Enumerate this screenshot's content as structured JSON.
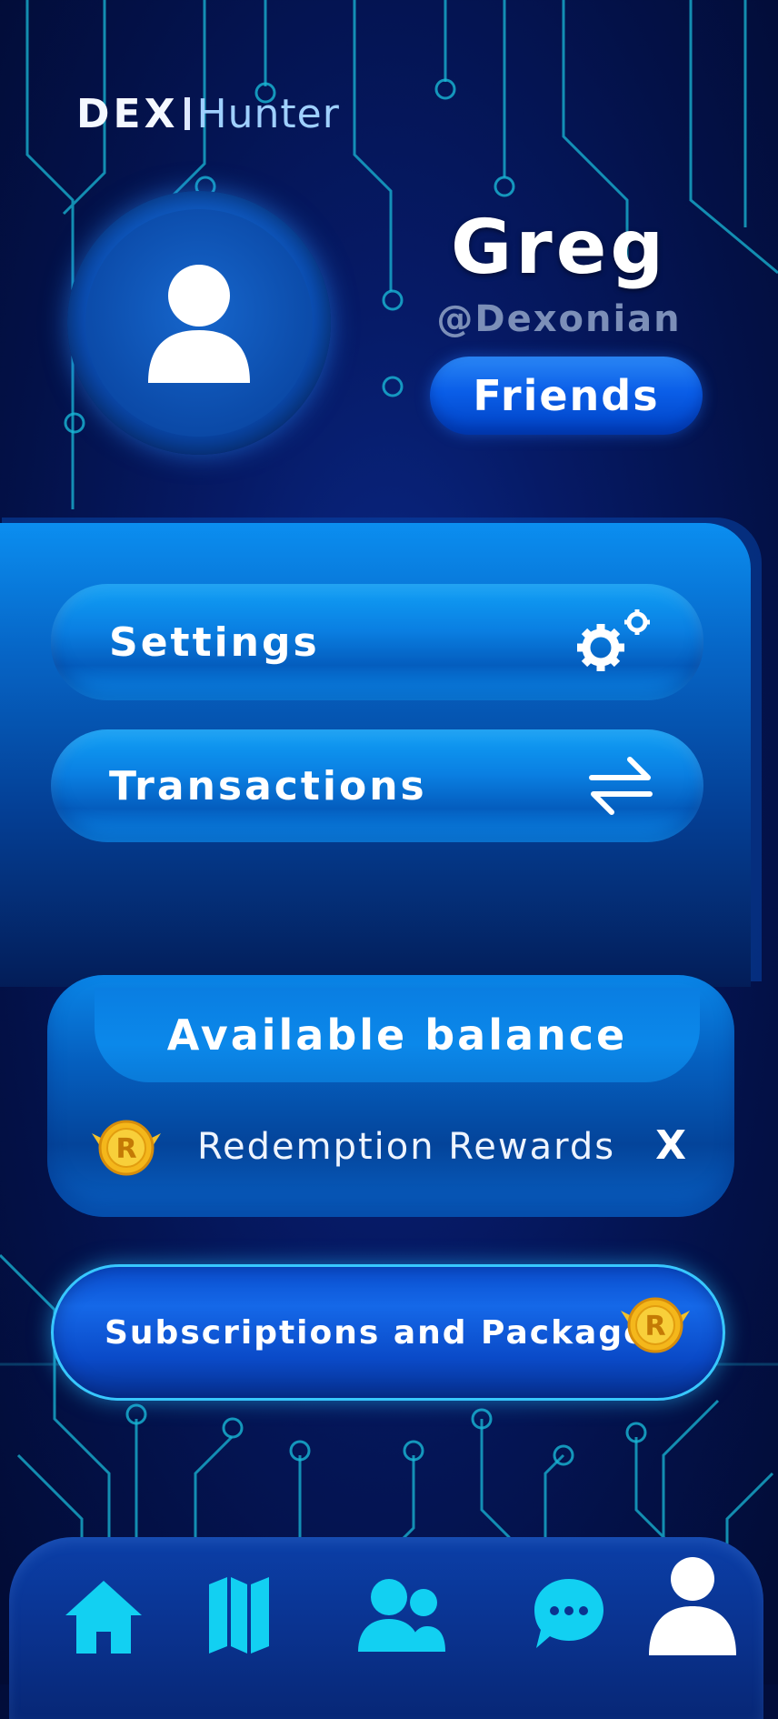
{
  "app": {
    "logo_primary": "DEX",
    "logo_secondary": "Hunter"
  },
  "profile": {
    "name": "Greg",
    "handle": "@Dexonian",
    "friends_label": "Friends"
  },
  "menu": {
    "settings_label": "Settings",
    "transactions_label": "Transactions"
  },
  "balance": {
    "title": "Available balance",
    "reward_label": "Redemption Rewards",
    "reward_value": "X",
    "coin_letter": "R"
  },
  "subscriptions": {
    "label": "Subscriptions and Packages"
  },
  "nav": {
    "items": [
      {
        "icon": "home-icon",
        "active": false
      },
      {
        "icon": "map-icon",
        "active": false
      },
      {
        "icon": "users-icon",
        "active": false
      },
      {
        "icon": "chat-icon",
        "active": false
      },
      {
        "icon": "profile-icon",
        "active": true
      }
    ]
  },
  "colors": {
    "background": "#031148",
    "accent": "#0a7fe2",
    "circuit": "#1fc4d8",
    "coin": "#f2b51c"
  }
}
